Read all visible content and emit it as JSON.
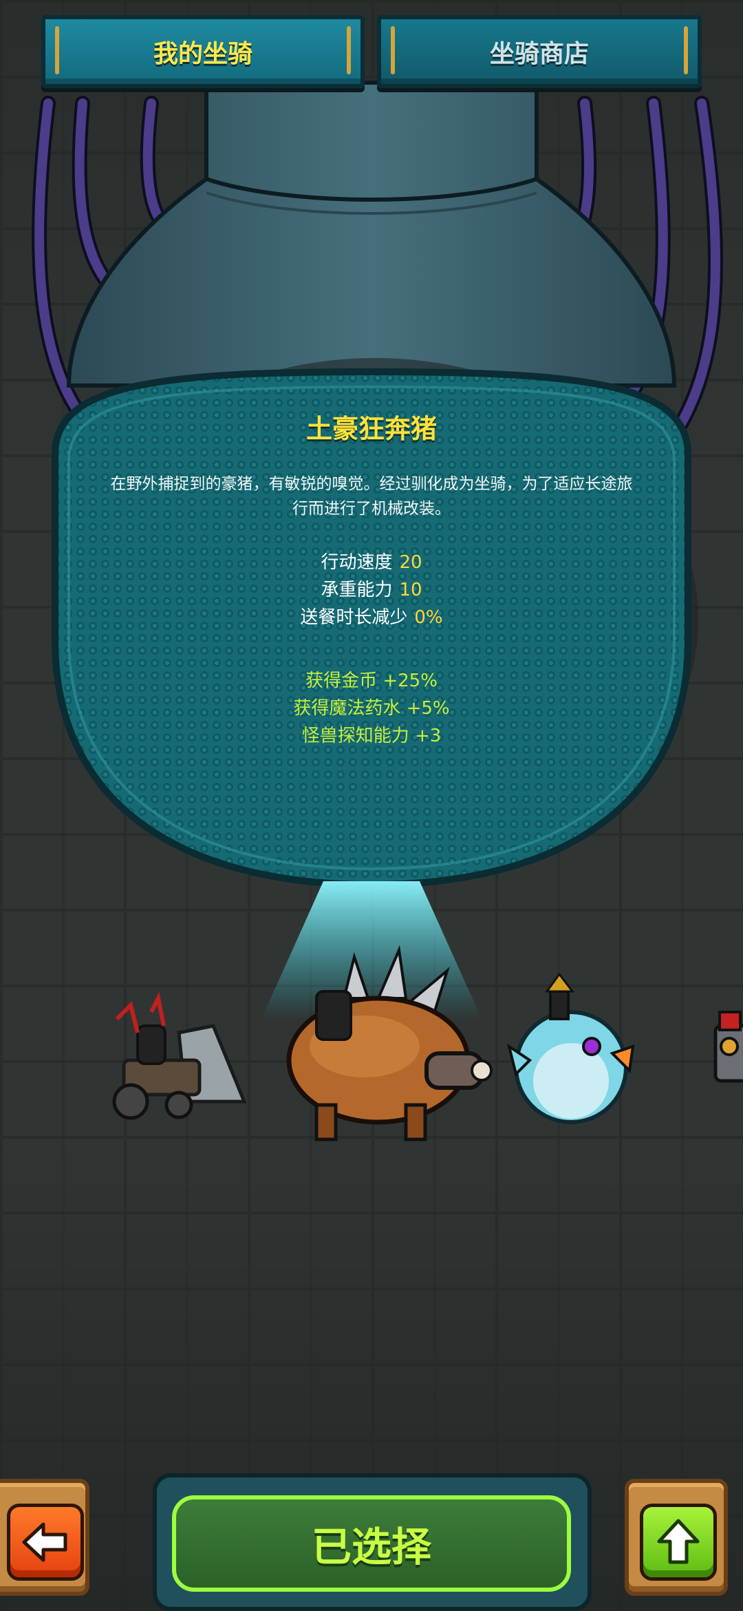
{
  "tabs": {
    "my_mounts": "我的坐骑",
    "mount_shop": "坐骑商店"
  },
  "mount": {
    "name": "土豪狂奔猪",
    "description": "在野外捕捉到的豪猪，有敏锐的嗅觉。经过驯化成为坐骑，为了适应长途旅行而进行了机械改装。",
    "stats": [
      {
        "label": "行动速度",
        "value": "20"
      },
      {
        "label": "承重能力",
        "value": "10"
      },
      {
        "label": "送餐时长减少",
        "value": "0%"
      }
    ],
    "bonuses": [
      "获得金币 +25%",
      "获得魔法药水 +5%",
      "怪兽探知能力 +3"
    ]
  },
  "carousel": {
    "items": [
      "drill-kart-mount",
      "armored-boar-mount",
      "pufferfish-mount",
      "mech-mount-partial"
    ],
    "selected": "armored-boar-mount"
  },
  "bottom_bar": {
    "select_label": "已选择",
    "back_icon": "arrow-left-icon",
    "up_icon": "arrow-up-icon"
  },
  "colors": {
    "title_yellow": "#ffe23a",
    "stat_value": "#ffd83a",
    "bonus_green": "#c7ef3a",
    "panel_teal": "#1a6e78"
  }
}
